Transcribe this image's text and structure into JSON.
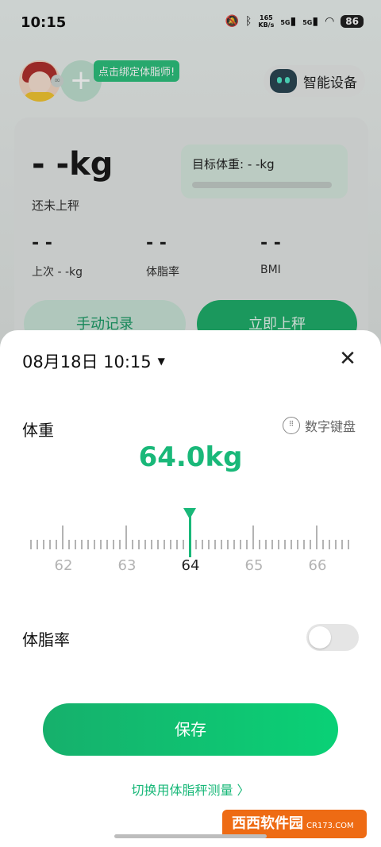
{
  "status_bar": {
    "time": "10:15",
    "net_speed": "165",
    "net_unit": "KB/s",
    "signal_label": "5G",
    "battery": "86"
  },
  "header": {
    "bind_tip": "点击绑定体脂师!",
    "smart_device": "智能设备"
  },
  "summary": {
    "weight": "- -kg",
    "status": "还未上秤",
    "target": "目标体重: - -kg",
    "metrics": [
      {
        "value": "- -",
        "label": "上次 - -kg"
      },
      {
        "value": "- -",
        "label": "体脂率"
      },
      {
        "value": "- -",
        "label": "BMI"
      }
    ],
    "manual_button": "手动记录",
    "weigh_button": "立即上秤"
  },
  "sheet": {
    "datetime": "08月18日 10:15",
    "weight_label": "体重",
    "keypad_label": "数字键盘",
    "weight_value": "64.0kg",
    "ruler": {
      "labels": [
        "62",
        "63",
        "64",
        "65",
        "66"
      ],
      "selected": "64"
    },
    "body_fat_label": "体脂率",
    "body_fat_enabled": false,
    "save_button": "保存",
    "switch_link": "切换用体脂秤测量 〉"
  },
  "watermark": {
    "text": "西西软件园",
    "sub": "CR173.COM"
  },
  "colors": {
    "accent": "#19b879",
    "tip": "#2dc07d"
  }
}
